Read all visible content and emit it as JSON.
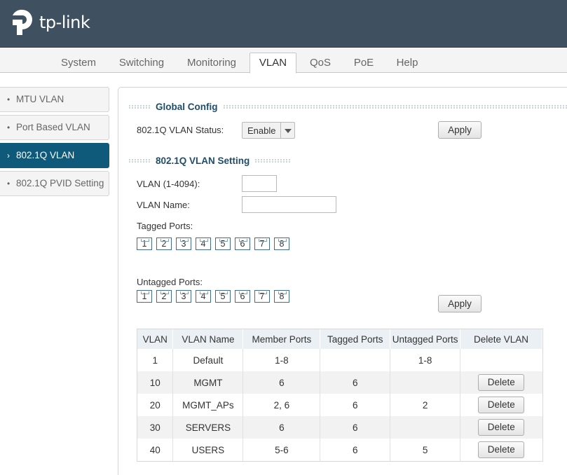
{
  "brand": {
    "name": "tp-link"
  },
  "nav": {
    "tabs": [
      {
        "label": "System"
      },
      {
        "label": "Switching"
      },
      {
        "label": "Monitoring"
      },
      {
        "label": "VLAN"
      },
      {
        "label": "QoS"
      },
      {
        "label": "PoE"
      },
      {
        "label": "Help"
      }
    ],
    "active": "VLAN"
  },
  "sidebar": {
    "items": [
      {
        "label": "MTU VLAN",
        "bullet": "•"
      },
      {
        "label": "Port Based VLAN",
        "bullet": "•"
      },
      {
        "label": "802.1Q VLAN",
        "bullet": "›"
      },
      {
        "label": "802.1Q PVID Setting",
        "bullet": "•"
      }
    ],
    "active": "802.1Q VLAN"
  },
  "global_config": {
    "title": "Global Config",
    "status_label": "802.1Q VLAN Status:",
    "status_value": "Enable",
    "apply_label": "Apply"
  },
  "vlan_setting": {
    "title": "802.1Q VLAN Setting",
    "vlan_id_label": "VLAN (1-4094):",
    "vlan_id_value": "",
    "vlan_name_label": "VLAN Name:",
    "vlan_name_value": "",
    "tagged_label": "Tagged Ports:",
    "untagged_label": "Untagged Ports:",
    "ports": [
      "1",
      "2",
      "3",
      "4",
      "5",
      "6",
      "7",
      "8"
    ],
    "apply_label": "Apply"
  },
  "table": {
    "headers": [
      "VLAN",
      "VLAN Name",
      "Member Ports",
      "Tagged Ports",
      "Untagged Ports",
      "Delete VLAN"
    ],
    "delete_label": "Delete",
    "rows": [
      {
        "vlan": "1",
        "name": "Default",
        "members": "1-8",
        "tagged": "",
        "untagged": "1-8",
        "deletable": false
      },
      {
        "vlan": "10",
        "name": "MGMT",
        "members": "6",
        "tagged": "6",
        "untagged": "",
        "deletable": true
      },
      {
        "vlan": "20",
        "name": "MGMT_APs",
        "members": "2, 6",
        "tagged": "6",
        "untagged": "2",
        "deletable": true
      },
      {
        "vlan": "30",
        "name": "SERVERS",
        "members": "6",
        "tagged": "6",
        "untagged": "",
        "deletable": true
      },
      {
        "vlan": "40",
        "name": "USERS",
        "members": "5-6",
        "tagged": "6",
        "untagged": "5",
        "deletable": true
      }
    ]
  },
  "colors": {
    "header_bg": "#3f5160",
    "active_side": "#0f5a7a",
    "section_title": "#1f4d6b"
  }
}
